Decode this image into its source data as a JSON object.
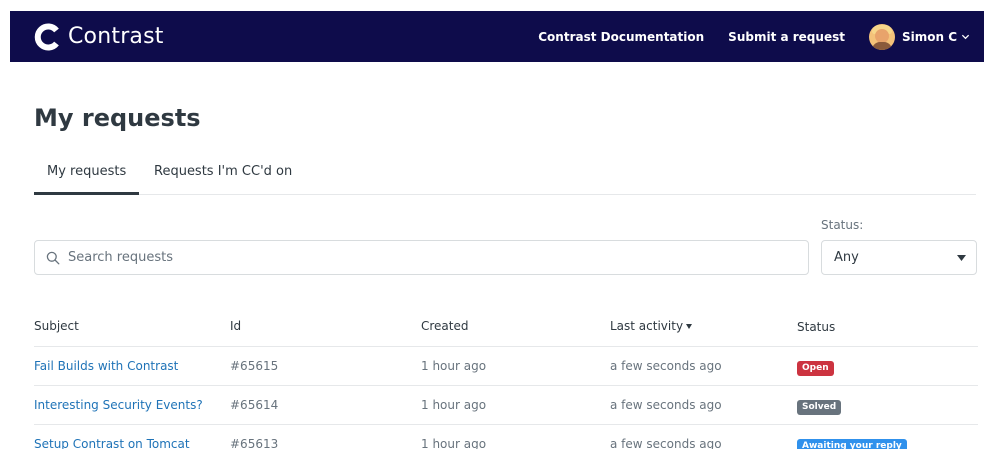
{
  "header": {
    "brand_name": "Contrast",
    "nav_links": [
      "Contrast Documentation",
      "Submit a request"
    ],
    "user_name": "Simon C",
    "background_color": "#0e0c4b"
  },
  "page": {
    "title": "My requests",
    "tabs": [
      {
        "label": "My requests",
        "active": true
      },
      {
        "label": "Requests I'm CC'd on",
        "active": false
      }
    ]
  },
  "filters": {
    "search_placeholder": "Search requests",
    "search_value": "",
    "status_label": "Status:",
    "status_value": "Any"
  },
  "table": {
    "columns": {
      "subject": "Subject",
      "id": "Id",
      "created": "Created",
      "last_activity": "Last activity",
      "status": "Status"
    },
    "sorted_by": "last_activity",
    "rows": [
      {
        "subject": "Fail Builds with Contrast",
        "id": "#65615",
        "created": "1 hour ago",
        "last_activity": "a few seconds ago",
        "status": "Open",
        "status_color": "#cc3340"
      },
      {
        "subject": "Interesting Security Events?",
        "id": "#65614",
        "created": "1 hour ago",
        "last_activity": "a few seconds ago",
        "status": "Solved",
        "status_color": "#68737d"
      },
      {
        "subject": "Setup Contrast on Tomcat",
        "id": "#65613",
        "created": "1 hour ago",
        "last_activity": "a few seconds ago",
        "status": "Awaiting your reply",
        "status_color": "#3091ec"
      }
    ]
  },
  "colors": {
    "link": "#1f73b7",
    "text": "#2f3941",
    "muted": "#68737d",
    "border": "#d8dcde"
  }
}
